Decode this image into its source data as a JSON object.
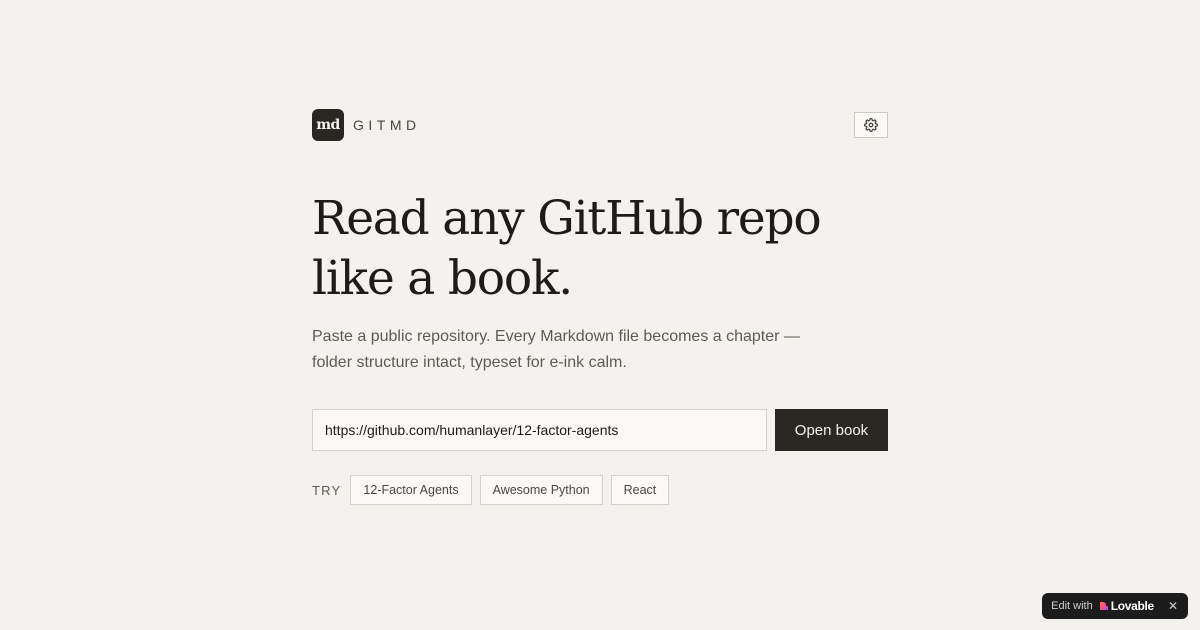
{
  "brand": {
    "logo_text": "md",
    "name": "GITMD"
  },
  "header": {
    "settings_icon": "gear-icon"
  },
  "hero": {
    "headline": "Read any GitHub repo like a book.",
    "subtitle": "Paste a public repository. Every Markdown file becomes a chapter — folder structure intact, typeset for e-ink calm."
  },
  "form": {
    "url_value": "https://github.com/humanlayer/12-factor-agents",
    "submit_label": "Open book"
  },
  "suggestions": {
    "label": "TRY",
    "items": [
      {
        "label": "12-Factor Agents"
      },
      {
        "label": "Awesome Python"
      },
      {
        "label": "React"
      }
    ]
  },
  "badge": {
    "edit_label": "Edit with",
    "brand_label": "Lovable",
    "close_label": "✕"
  },
  "colors": {
    "background": "#f4f2ee",
    "primary": "#2b2823",
    "text": "#1e1c19",
    "muted": "#5e5a53"
  }
}
